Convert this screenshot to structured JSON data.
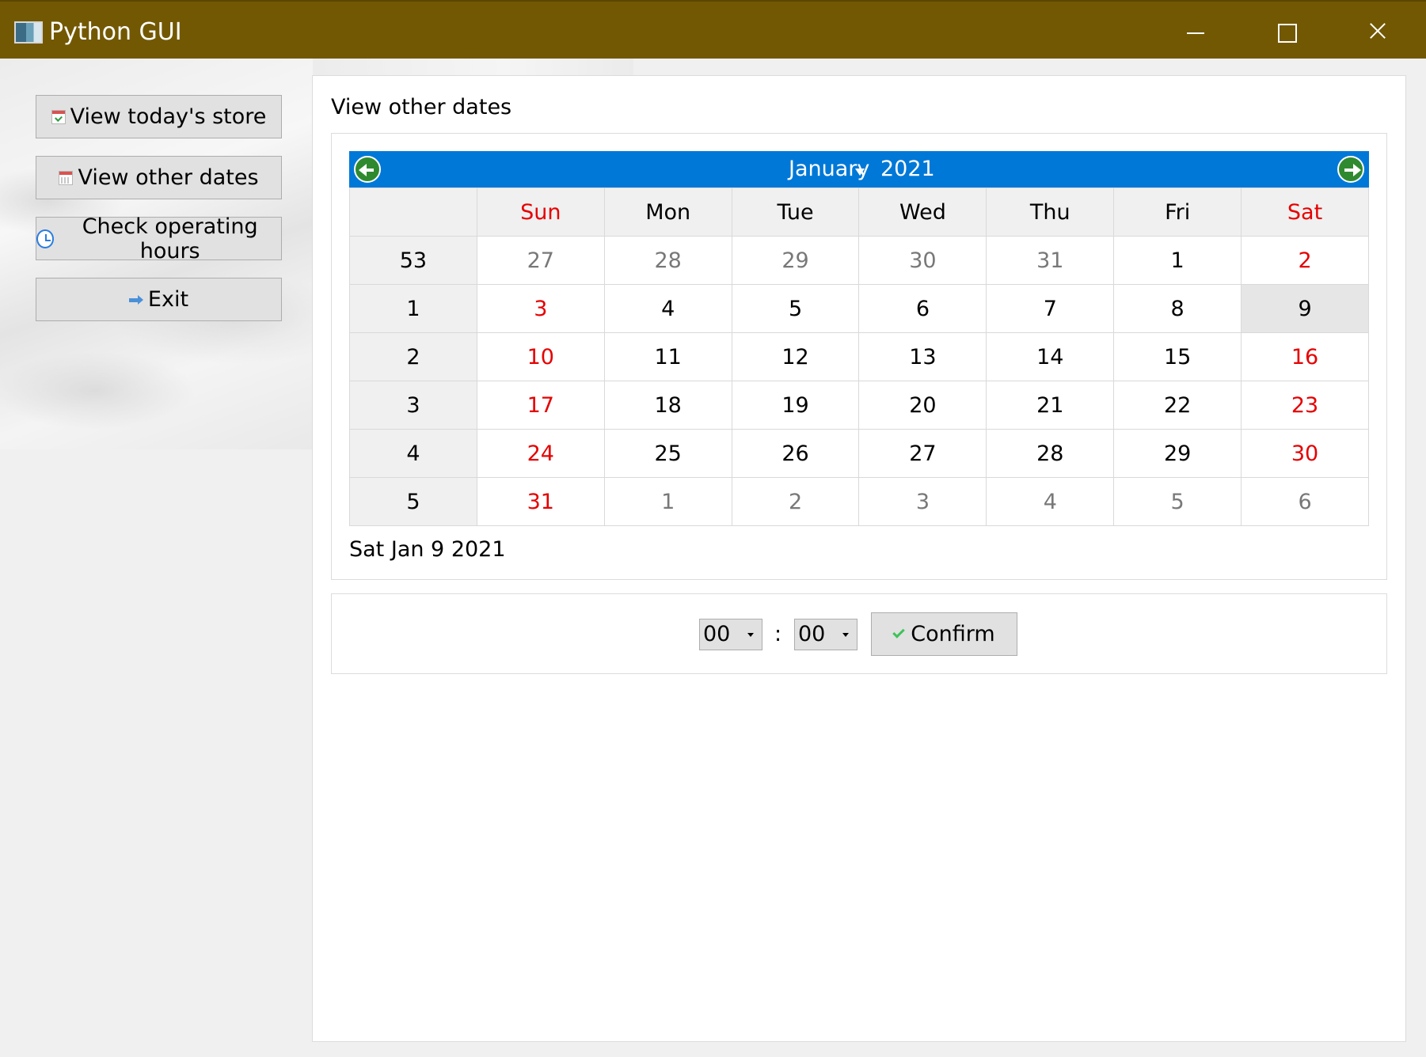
{
  "window": {
    "title": "Python GUI"
  },
  "sidebar": {
    "buttons": [
      {
        "label": "View today's store",
        "icon": "calendar-check-icon"
      },
      {
        "label": "View other dates",
        "icon": "calendar-icon"
      },
      {
        "label": "Check operating hours",
        "icon": "clock-icon"
      },
      {
        "label": "Exit",
        "icon": "exit-arrow-icon"
      }
    ]
  },
  "main": {
    "section_label": "View other dates",
    "calendar": {
      "month": "January",
      "year": "2021",
      "headers": [
        "",
        "Sun",
        "Mon",
        "Tue",
        "Wed",
        "Thu",
        "Fri",
        "Sat"
      ],
      "weeks": [
        {
          "week": "53",
          "days": [
            "27",
            "28",
            "29",
            "30",
            "31",
            "1",
            "2"
          ]
        },
        {
          "week": "1",
          "days": [
            "3",
            "4",
            "5",
            "6",
            "7",
            "8",
            "9"
          ]
        },
        {
          "week": "2",
          "days": [
            "10",
            "11",
            "12",
            "13",
            "14",
            "15",
            "16"
          ]
        },
        {
          "week": "3",
          "days": [
            "17",
            "18",
            "19",
            "20",
            "21",
            "22",
            "23"
          ]
        },
        {
          "week": "4",
          "days": [
            "24",
            "25",
            "26",
            "27",
            "28",
            "29",
            "30"
          ]
        },
        {
          "week": "5",
          "days": [
            "31",
            "1",
            "2",
            "3",
            "4",
            "5",
            "6"
          ]
        }
      ],
      "selected_date": "Sat Jan 9 2021",
      "colors": {
        "header": "#0078d7",
        "weekend": "#e60000"
      }
    },
    "time": {
      "hour": "00",
      "separator": ":",
      "minute": "00",
      "confirm_label": "Confirm"
    }
  }
}
